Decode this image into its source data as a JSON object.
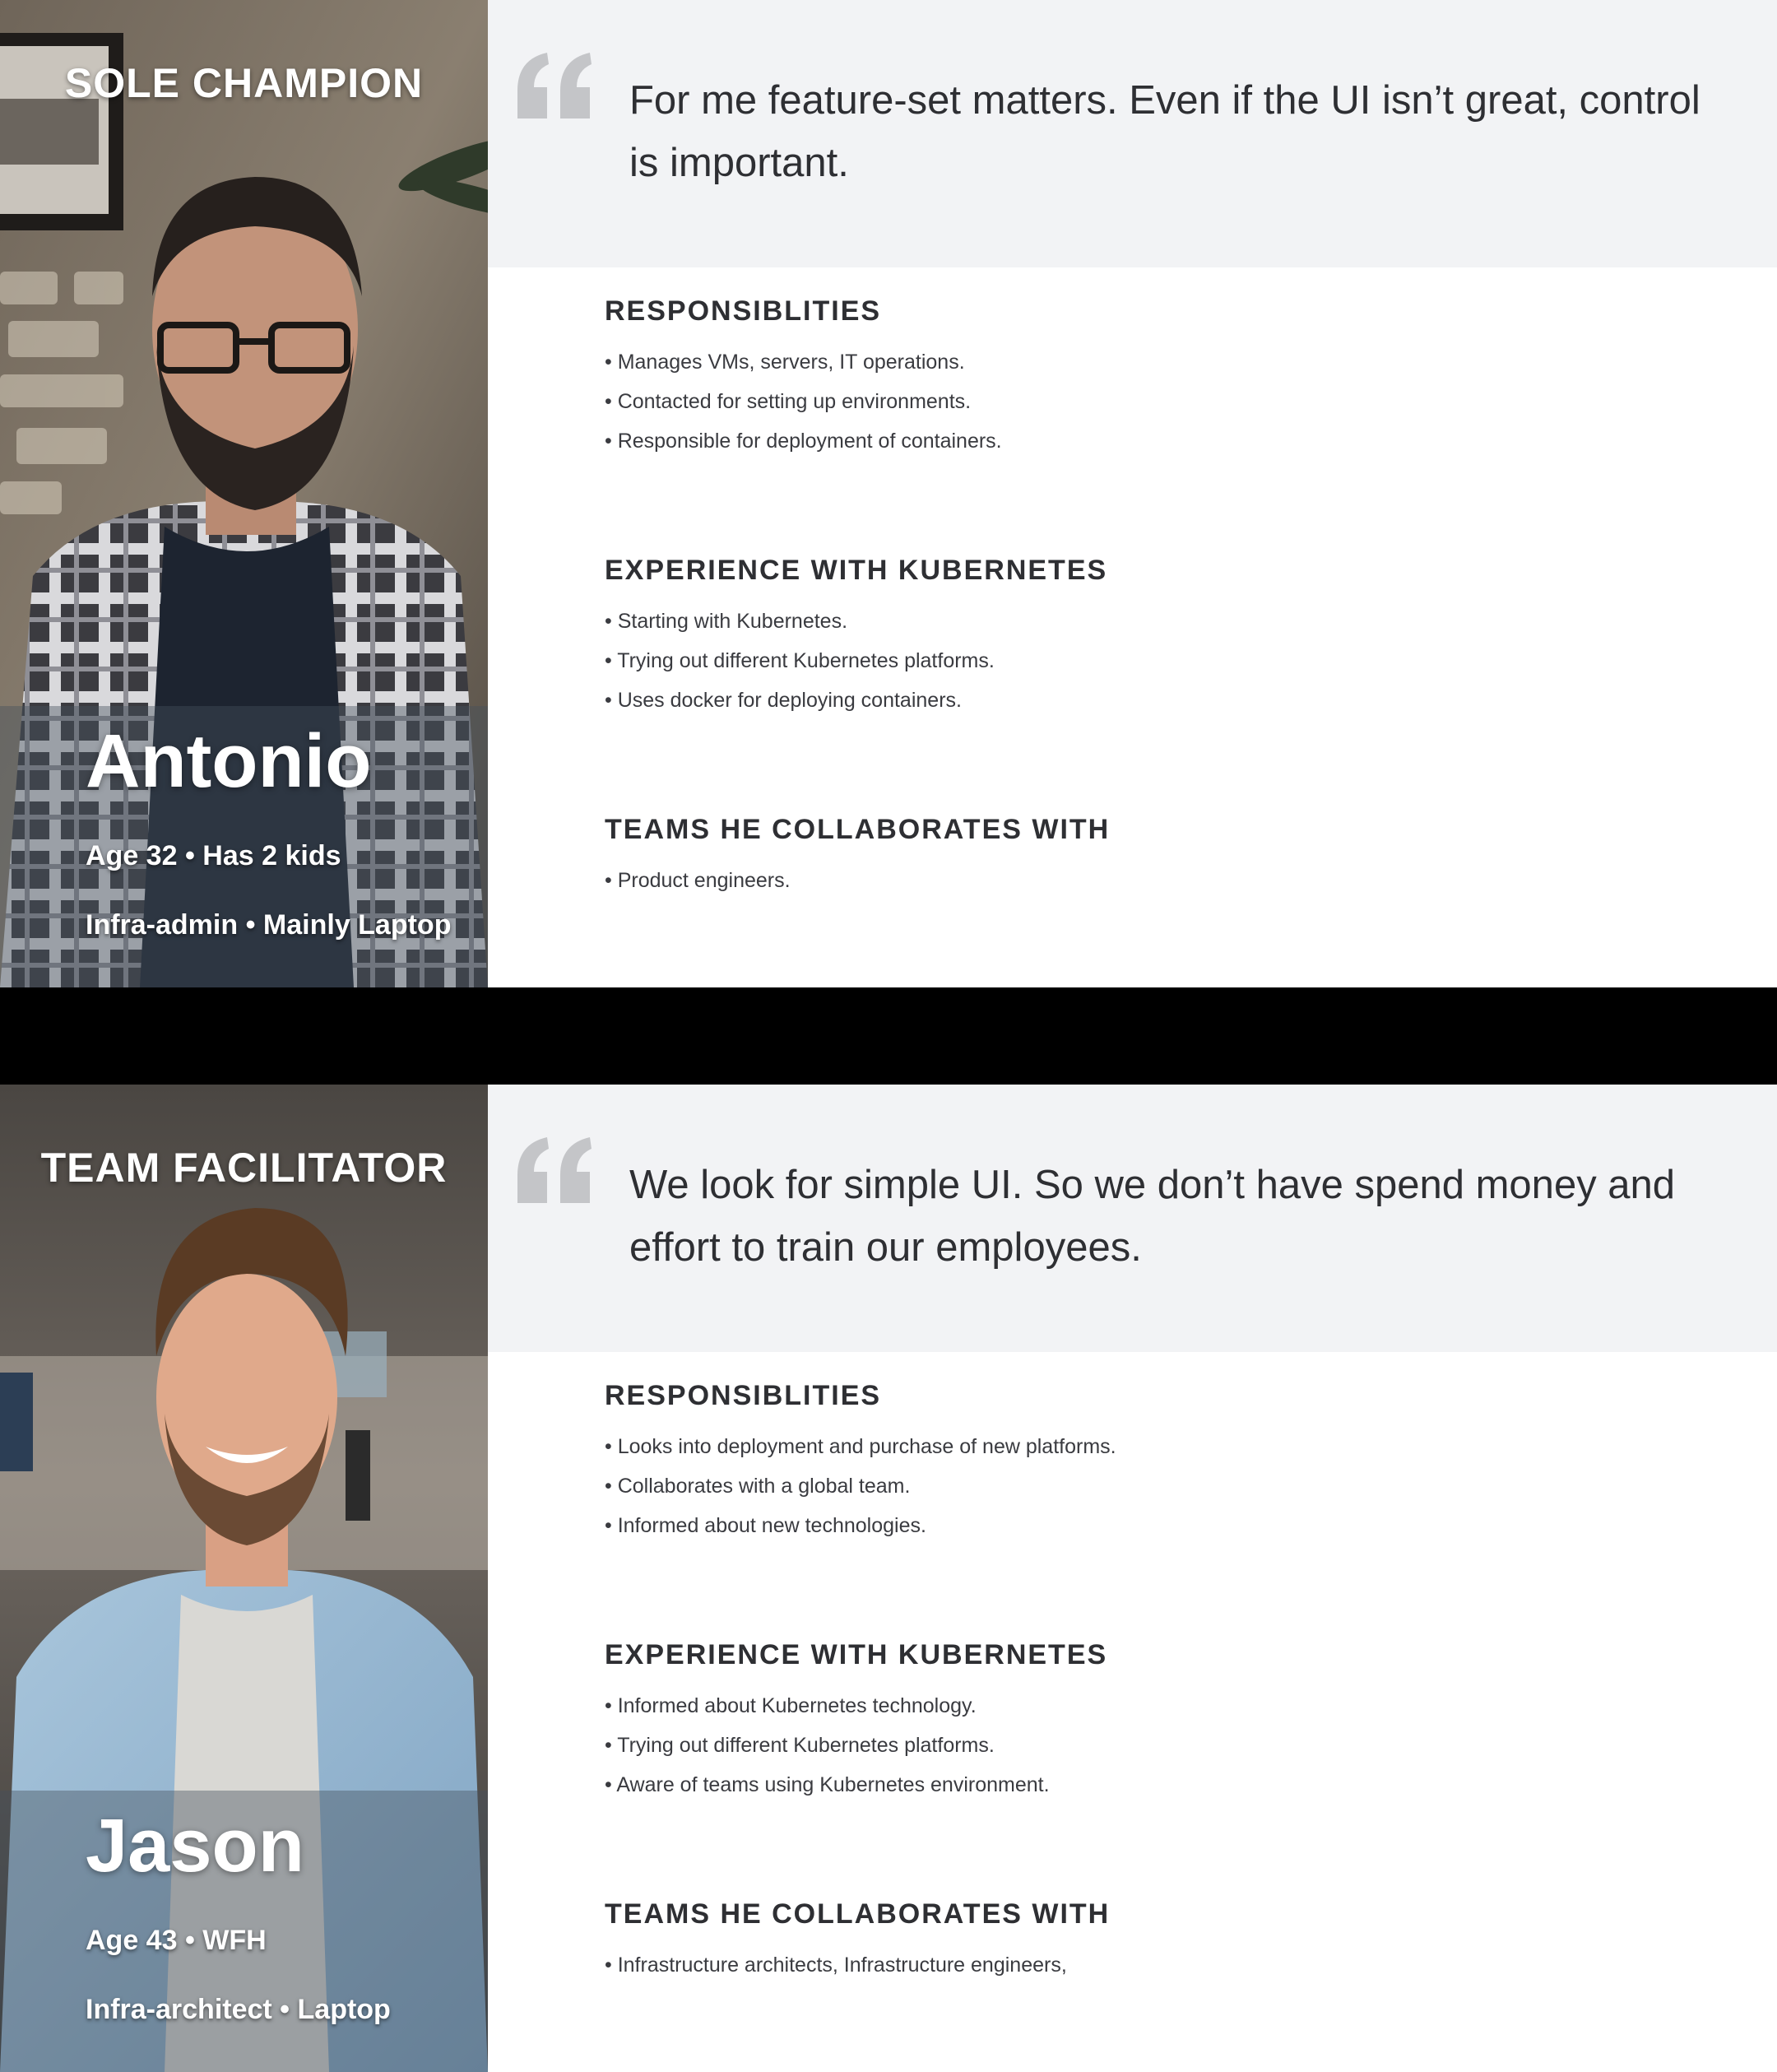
{
  "personas": [
    {
      "role": "SOLE CHAMPION",
      "name": "Antonio",
      "meta_line_1": "Age 32 • Has 2 kids",
      "meta_line_2": "Infra-admin • Mainly Laptop",
      "quote": "For me feature-set matters. Even if the UI isn’t great, control is important.",
      "sections": [
        {
          "heading": "RESPONSIBLITIES",
          "items": [
            "• Manages VMs, servers, IT operations.",
            "• Contacted for setting up environments.",
            "• Responsible for deployment of containers."
          ]
        },
        {
          "heading": "EXPERIENCE WITH KUBERNETES",
          "items": [
            "• Starting with Kubernetes.",
            "• Trying out different Kubernetes platforms.",
            "• Uses docker for deploying containers."
          ]
        },
        {
          "heading": "TEAMS HE COLLABORATES WITH",
          "items": [
            "• Product engineers."
          ]
        }
      ]
    },
    {
      "role": "TEAM FACILITATOR",
      "name": "Jason",
      "meta_line_1": "Age 43 • WFH",
      "meta_line_2": "Infra-architect • Laptop",
      "quote": "We look for simple UI. So we don’t have spend money and effort to train our employees.",
      "sections": [
        {
          "heading": "RESPONSIBLITIES",
          "items": [
            "• Looks into deployment and purchase of new platforms.",
            "• Collaborates with a global team.",
            "• Informed about new technologies."
          ]
        },
        {
          "heading": "EXPERIENCE WITH KUBERNETES",
          "items": [
            "• Informed about Kubernetes technology.",
            "• Trying out different Kubernetes platforms.",
            "• Aware of teams using Kubernetes environment."
          ]
        },
        {
          "heading": "TEAMS HE COLLABORATES WITH",
          "items": [
            "• Infrastructure architects, Infrastructure engineers,"
          ]
        }
      ]
    }
  ],
  "colors": {
    "quote_panel_bg": "#f2f3f5",
    "heading_text": "#2e2f33",
    "body_text": "#3a3b40",
    "quote_mark": "#c4c5c8",
    "divider_band": "#000000"
  }
}
